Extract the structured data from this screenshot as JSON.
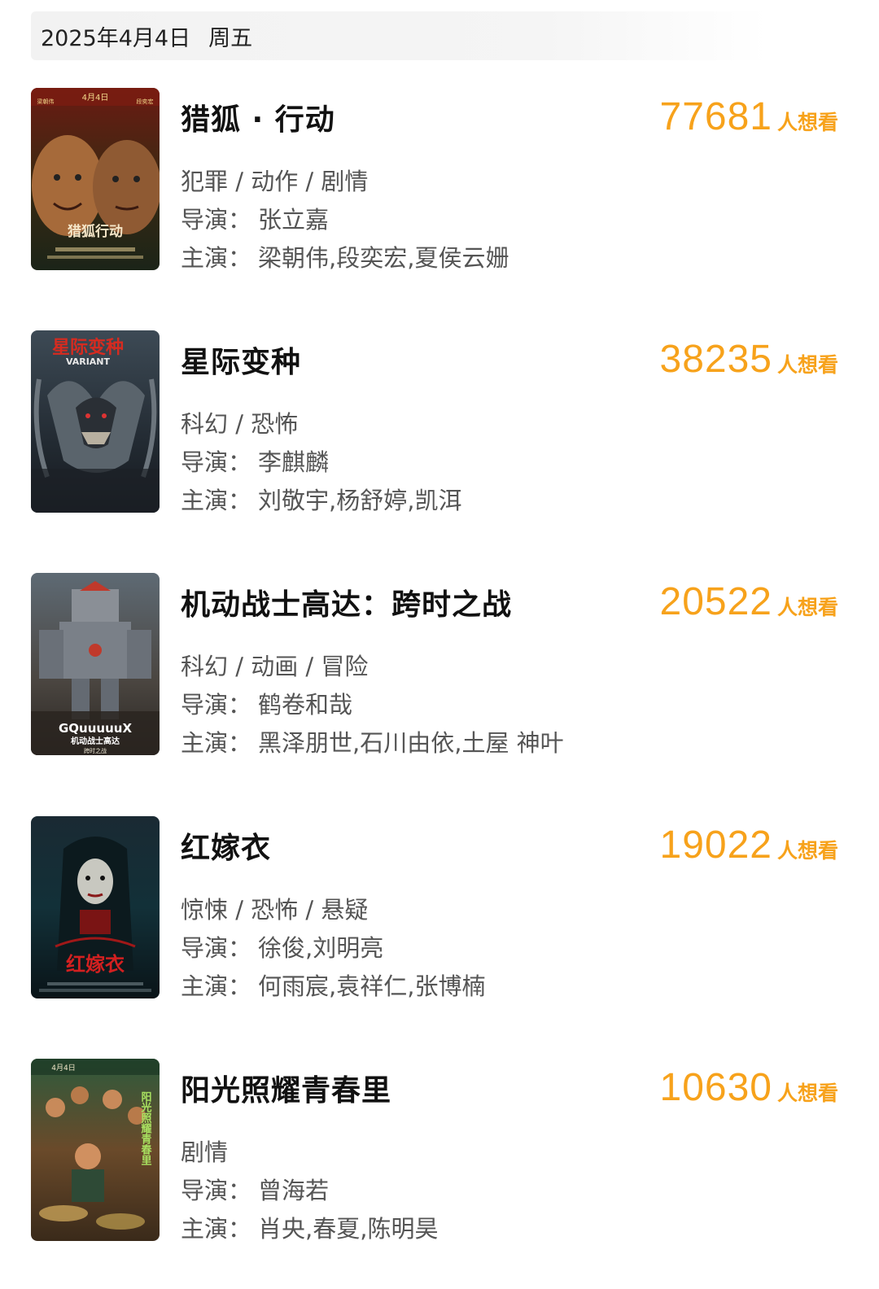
{
  "header": {
    "date": "2025年4月4日",
    "weekday": "周五"
  },
  "labels": {
    "want_suffix": "人想看",
    "director": "导演：",
    "cast": "主演："
  },
  "colors": {
    "accent": "#f7a21b"
  },
  "movies": [
    {
      "title": "猎狐 · 行动",
      "want_count": "77681",
      "genres": "犯罪 / 动作 / 剧情",
      "director": "张立嘉",
      "cast": "梁朝伟,段奕宏,夏侯云姗",
      "poster_text": [
        "4月4日",
        "梁朝伟",
        "段奕宏",
        "猎狐行动"
      ]
    },
    {
      "title": "星际变种",
      "want_count": "38235",
      "genres": "科幻 / 恐怖",
      "director": "李麒麟",
      "cast": "刘敬宇,杨舒婷,凯洱",
      "poster_text": [
        "星际变种",
        "VARIANT"
      ]
    },
    {
      "title": "机动战士高达：跨时之战",
      "want_count": "20522",
      "genres": "科幻 / 动画 / 冒险",
      "director": "鹤卷和哉",
      "cast": "黑泽朋世,石川由依,土屋 神叶",
      "poster_text": [
        "GQuuuuuX",
        "机动战士高达",
        "跨时之战"
      ]
    },
    {
      "title": "红嫁衣",
      "want_count": "19022",
      "genres": "惊悚 / 恐怖 / 悬疑",
      "director": "徐俊,刘明亮",
      "cast": "何雨宸,袁祥仁,张博楠",
      "poster_text": [
        "红嫁衣"
      ]
    },
    {
      "title": "阳光照耀青春里",
      "want_count": "10630",
      "genres": "剧情",
      "director": "曾海若",
      "cast": "肖央,春夏,陈明昊",
      "poster_text": [
        "4月4日",
        "阳光照耀青春里"
      ]
    }
  ]
}
